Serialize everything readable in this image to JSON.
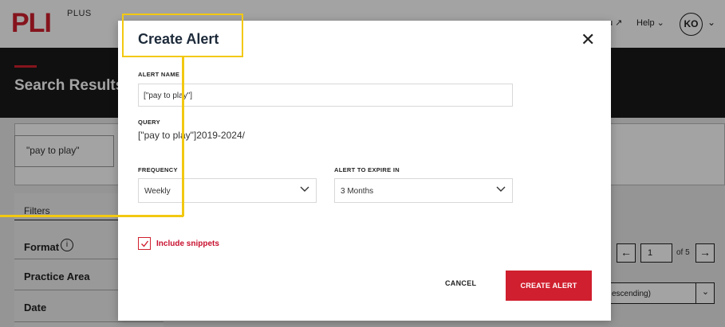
{
  "app": {
    "logo_text": "PLI",
    "logo_suffix": "PLUS",
    "nav_menu": "u ↗",
    "nav_help": "Help ⌄",
    "avatar_initials": "KO",
    "avatar_chevron": "⌄"
  },
  "page": {
    "title": "Search Results",
    "search_value": "\"pay to play\"",
    "filters_title": "Filters",
    "filters": [
      {
        "label": "Format"
      },
      {
        "label": "Practice Area"
      },
      {
        "label": "Date"
      }
    ],
    "info_icon_glyph": "i",
    "pager": {
      "prev_glyph": "←",
      "current_page": "1",
      "of_text": "of 5",
      "next_glyph": "→"
    },
    "sort_value": "escending)",
    "sort_chevron": "⌄"
  },
  "modal": {
    "title": "Create Alert",
    "close_glyph": "✕",
    "alert_name_label": "ALERT NAME",
    "alert_name_value": "[\"pay to play\"]",
    "query_label": "QUERY",
    "query_value": "[\"pay to play\"]2019-2024/",
    "frequency_label": "FREQUENCY",
    "frequency_value": "Weekly",
    "expire_label": "ALERT TO EXPIRE IN",
    "expire_value": "3 Months",
    "include_snippets_label": "Include snippets",
    "include_snippets_checked": true,
    "cancel_label": "CANCEL",
    "create_label": "CREATE ALERT"
  },
  "colors": {
    "brand_red": "#d01f2e",
    "highlight_yellow": "#f2c811",
    "header_dark": "#1a1a1a"
  }
}
